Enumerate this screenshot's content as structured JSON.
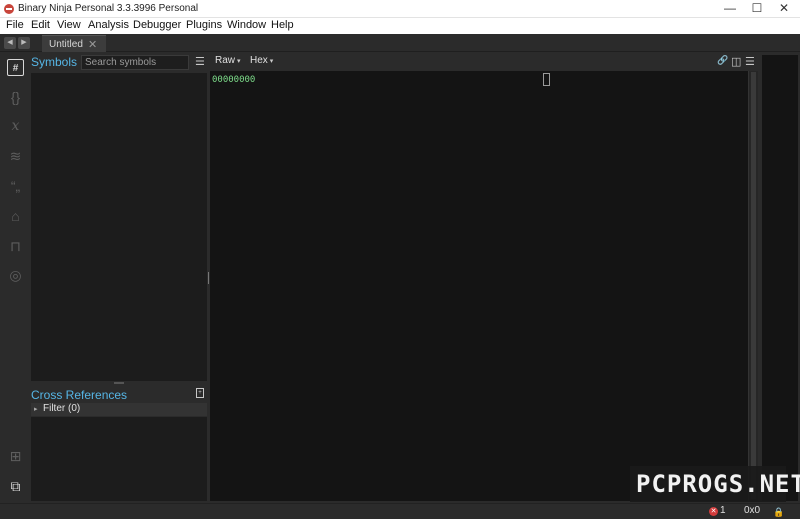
{
  "window": {
    "title": "Binary Ninja Personal 3.3.3996 Personal",
    "controls": {
      "minimize": "—",
      "maximize": "☐",
      "close": "✕"
    }
  },
  "menu": [
    "File",
    "Edit",
    "View",
    "Analysis",
    "Debugger",
    "Plugins",
    "Window",
    "Help"
  ],
  "tabs": [
    {
      "label": "Untitled",
      "close": "✕"
    }
  ],
  "nav": {
    "back": "◀",
    "forward": "▶"
  },
  "activity_bar": [
    {
      "icon": "symbols-icon",
      "glyph": "#",
      "active": true
    },
    {
      "icon": "types-icon",
      "glyph": "{}"
    },
    {
      "icon": "variables-icon",
      "glyph": "𝑥"
    },
    {
      "icon": "layers-icon",
      "glyph": "≋"
    },
    {
      "icon": "strings-icon",
      "glyph": "“„"
    },
    {
      "icon": "tags-icon",
      "glyph": "⌂"
    },
    {
      "icon": "stack-icon",
      "glyph": "⊓"
    },
    {
      "icon": "settings-icon",
      "glyph": "◎"
    },
    {
      "icon": "graph-icon",
      "glyph": "⊞"
    },
    {
      "icon": "linked-view-icon",
      "glyph": "⧉",
      "active": true
    }
  ],
  "symbols": {
    "title": "Symbols",
    "search_placeholder": "Search symbols",
    "menu_glyph": "☰"
  },
  "cross_references": {
    "title": "Cross References",
    "filter_label": "Filter (0)",
    "filter_arrow": "▸",
    "icon_glyph": "+"
  },
  "hex_view": {
    "view_type": "Raw",
    "view_mode": "Hex",
    "caret": "▾",
    "first_address": "00000000",
    "link_glyph": "🔗",
    "split_glyph": "◫",
    "menu_glyph": "☰"
  },
  "status": {
    "error_badge": "✕",
    "error_count": "1",
    "offset": "0x0",
    "lock_glyph": "🔒"
  },
  "watermark": "PCPROGS.NET",
  "colors": {
    "accent": "#56b6e6",
    "address": "#7ddc8a",
    "error": "#d23c3c",
    "background": "#2b2b2b",
    "panel": "#1c1c1c",
    "editor": "#141414"
  }
}
